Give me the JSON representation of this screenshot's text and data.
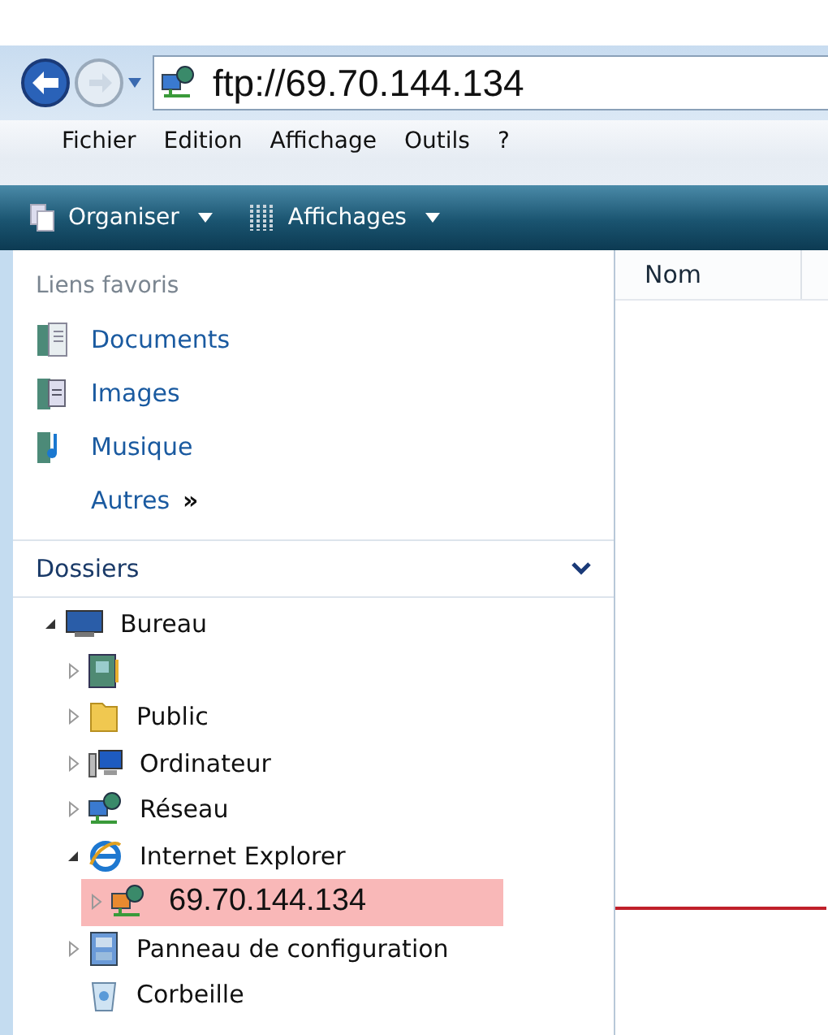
{
  "address_bar": {
    "value": "ftp://69.70.144.134"
  },
  "menu_bar": [
    "Fichier",
    "Edition",
    "Affichage",
    "Outils",
    "?"
  ],
  "toolbar": [
    {
      "label": "Organiser",
      "kind": "pages"
    },
    {
      "label": "Affichages",
      "kind": "views"
    }
  ],
  "favorites": {
    "title": "Liens favoris",
    "items": [
      {
        "label": "Documents",
        "kind": "documents"
      },
      {
        "label": "Images",
        "kind": "images"
      },
      {
        "label": "Musique",
        "kind": "music"
      }
    ],
    "more": {
      "label": "Autres",
      "glyph": "»"
    }
  },
  "folders": {
    "title": "Dossiers",
    "expanded": true,
    "tree": [
      {
        "label": "Bureau",
        "kind": "desktop",
        "expanded": true,
        "highlighted": false,
        "children": [
          {
            "kind": "contact",
            "expanded": false,
            "highlighted": false
          },
          {
            "label": "Public",
            "kind": "folder",
            "expanded": false,
            "highlighted": false
          },
          {
            "label": "Ordinateur",
            "kind": "computer",
            "expanded": false,
            "highlighted": false
          },
          {
            "label": "Réseau",
            "kind": "network",
            "expanded": false,
            "highlighted": false
          },
          {
            "label": "Internet Explorer",
            "kind": "browser",
            "expanded": true,
            "highlighted": false,
            "children": [
              {
                "label": "69.70.144.134",
                "kind": "ftp",
                "expanded": false,
                "highlighted": true
              }
            ]
          },
          {
            "label": "Panneau de configuration",
            "kind": "control-panel",
            "expanded": false,
            "highlighted": false
          },
          {
            "label": "Corbeille",
            "kind": "recycle-bin",
            "highlighted": false
          }
        ]
      }
    ]
  },
  "file_list": {
    "columns": [
      "Nom"
    ]
  }
}
